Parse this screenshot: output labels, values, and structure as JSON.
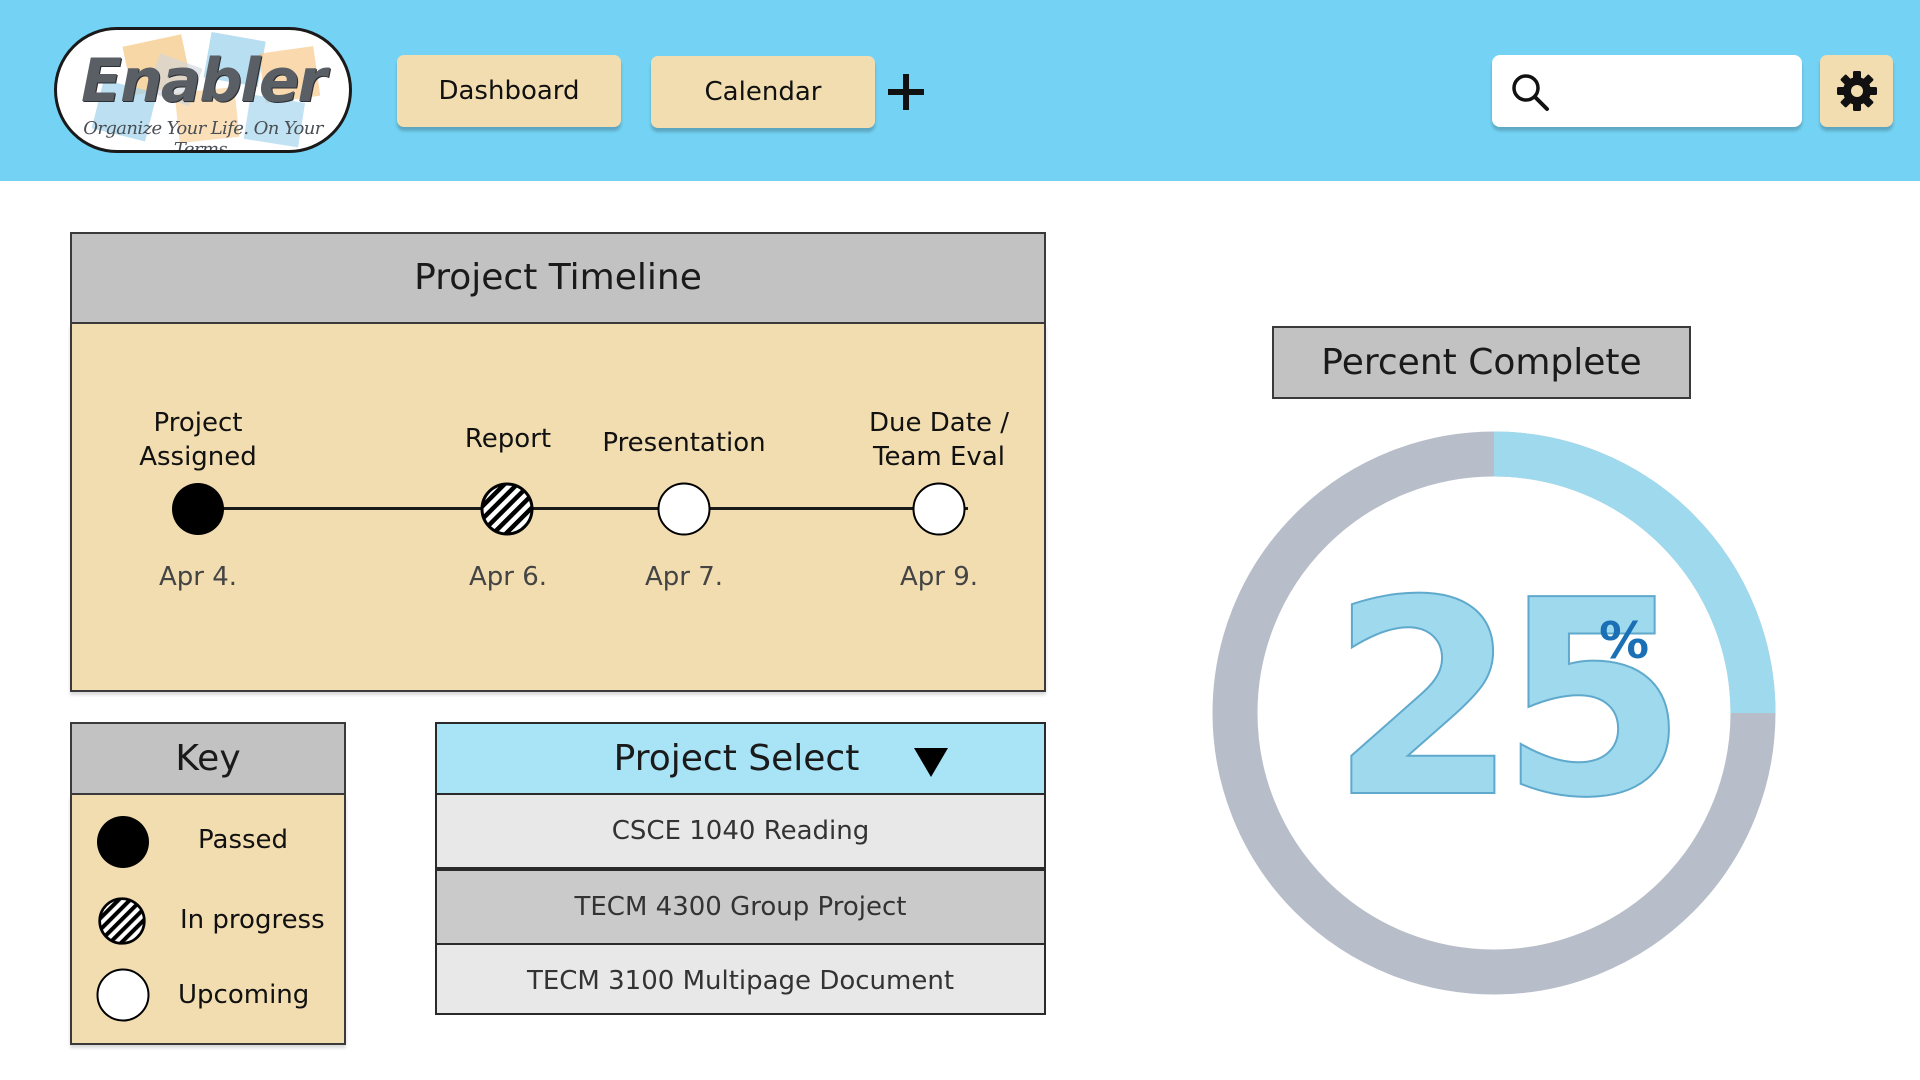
{
  "header": {
    "logo_word": "Enabler",
    "logo_tagline": "Organize Your Life. On Your Terms.",
    "nav": [
      "Dashboard",
      "Calendar"
    ],
    "search": {
      "value": "",
      "placeholder": ""
    },
    "colors": {
      "bar": "#74d3f4",
      "button": "#f2ddb0"
    }
  },
  "timeline": {
    "title": "Project Timeline",
    "milestones": [
      {
        "label": "Project\nAssigned",
        "date": "Apr 4.",
        "status": "passed"
      },
      {
        "label": "Report",
        "date": "Apr 6.",
        "status": "in-progress"
      },
      {
        "label": "Presentation",
        "date": "Apr 7.",
        "status": "upcoming"
      },
      {
        "label": "Due Date /\nTeam Eval",
        "date": "Apr 9.",
        "status": "upcoming"
      }
    ]
  },
  "key": {
    "title": "Key",
    "items": [
      {
        "label": "Passed",
        "status": "passed"
      },
      {
        "label": "In progress",
        "status": "in-progress"
      },
      {
        "label": "Upcoming",
        "status": "upcoming"
      }
    ]
  },
  "project_select": {
    "title": "Project Select",
    "options": [
      "CSCE 1040 Reading",
      "TECM 4300 Group Project",
      "TECM 3100 Multipage Document"
    ]
  },
  "progress": {
    "title": "Percent Complete",
    "number": "25",
    "unit": "%",
    "fraction": 0.25,
    "colors": {
      "fill": "#9fd9ee",
      "track": "#b8bec9"
    }
  }
}
